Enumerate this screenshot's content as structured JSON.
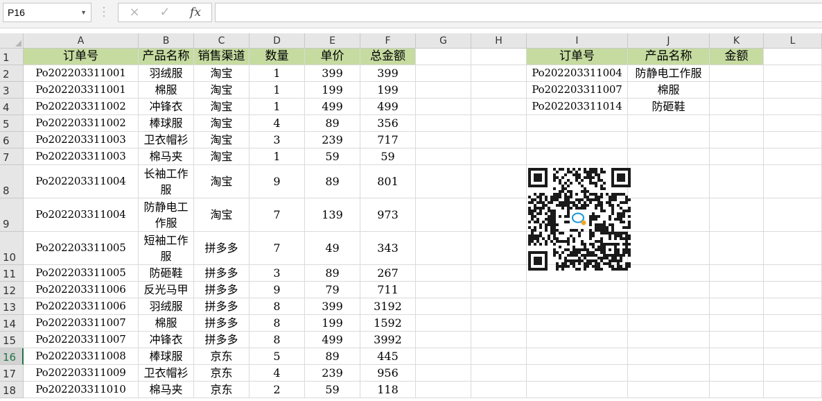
{
  "formula_bar": {
    "name_box": "P16",
    "cancel_icon": "×",
    "enter_icon": "✓",
    "fx_label": "fx",
    "formula": ""
  },
  "sheet": {
    "columns": [
      "A",
      "B",
      "C",
      "D",
      "E",
      "F",
      "G",
      "H",
      "I",
      "J",
      "K",
      "L"
    ],
    "selected_row": 16,
    "rows": [
      [
        "订单号",
        "产品名称",
        "销售渠道",
        "数量",
        "单价",
        "总金额",
        "",
        "",
        "订单号",
        "产品名称",
        "金额",
        ""
      ],
      [
        "Po202203311001",
        "羽绒服",
        "淘宝",
        "1",
        "399",
        "399",
        "",
        "",
        "Po202203311004",
        "防静电工作服",
        "",
        ""
      ],
      [
        "Po202203311001",
        "棉服",
        "淘宝",
        "1",
        "199",
        "199",
        "",
        "",
        "Po202203311007",
        "棉服",
        "",
        ""
      ],
      [
        "Po202203311002",
        "冲锋衣",
        "淘宝",
        "1",
        "499",
        "499",
        "",
        "",
        "Po202203311014",
        "防砸鞋",
        "",
        ""
      ],
      [
        "Po202203311002",
        "棒球服",
        "淘宝",
        "4",
        "89",
        "356",
        "",
        "",
        "",
        "",
        "",
        ""
      ],
      [
        "Po202203311003",
        "卫衣帽衫",
        "淘宝",
        "3",
        "239",
        "717",
        "",
        "",
        "",
        "",
        "",
        ""
      ],
      [
        "Po202203311003",
        "棉马夹",
        "淘宝",
        "1",
        "59",
        "59",
        "",
        "",
        "",
        "",
        "",
        ""
      ],
      [
        "Po202203311004",
        "长袖工作服",
        "淘宝",
        "9",
        "89",
        "801",
        "",
        "",
        "",
        "",
        "",
        ""
      ],
      [
        "Po202203311004",
        "防静电工作服",
        "淘宝",
        "7",
        "139",
        "973",
        "",
        "",
        "",
        "",
        "",
        ""
      ],
      [
        "Po202203311005",
        "短袖工作服",
        "拼多多",
        "7",
        "49",
        "343",
        "",
        "",
        "",
        "",
        "",
        ""
      ],
      [
        "Po202203311005",
        "防砸鞋",
        "拼多多",
        "3",
        "89",
        "267",
        "",
        "",
        "",
        "",
        "",
        ""
      ],
      [
        "Po202203311006",
        "反光马甲",
        "拼多多",
        "9",
        "79",
        "711",
        "",
        "",
        "",
        "",
        "",
        ""
      ],
      [
        "Po202203311006",
        "羽绒服",
        "拼多多",
        "8",
        "399",
        "3192",
        "",
        "",
        "",
        "",
        "",
        ""
      ],
      [
        "Po202203311007",
        "棉服",
        "拼多多",
        "8",
        "199",
        "1592",
        "",
        "",
        "",
        "",
        "",
        ""
      ],
      [
        "Po202203311007",
        "冲锋衣",
        "拼多多",
        "8",
        "499",
        "3992",
        "",
        "",
        "",
        "",
        "",
        ""
      ],
      [
        "Po202203311008",
        "棒球服",
        "京东",
        "5",
        "89",
        "445",
        "",
        "",
        "",
        "",
        "",
        ""
      ],
      [
        "Po202203311009",
        "卫衣帽衫",
        "京东",
        "4",
        "239",
        "956",
        "",
        "",
        "",
        "",
        "",
        ""
      ],
      [
        "Po202203311010",
        "棉马夹",
        "京东",
        "2",
        "59",
        "118",
        "",
        "",
        "",
        "",
        "",
        ""
      ]
    ]
  },
  "image": {
    "icon": "qr-code-icon",
    "center_icon": "wechat-logo-icon"
  }
}
